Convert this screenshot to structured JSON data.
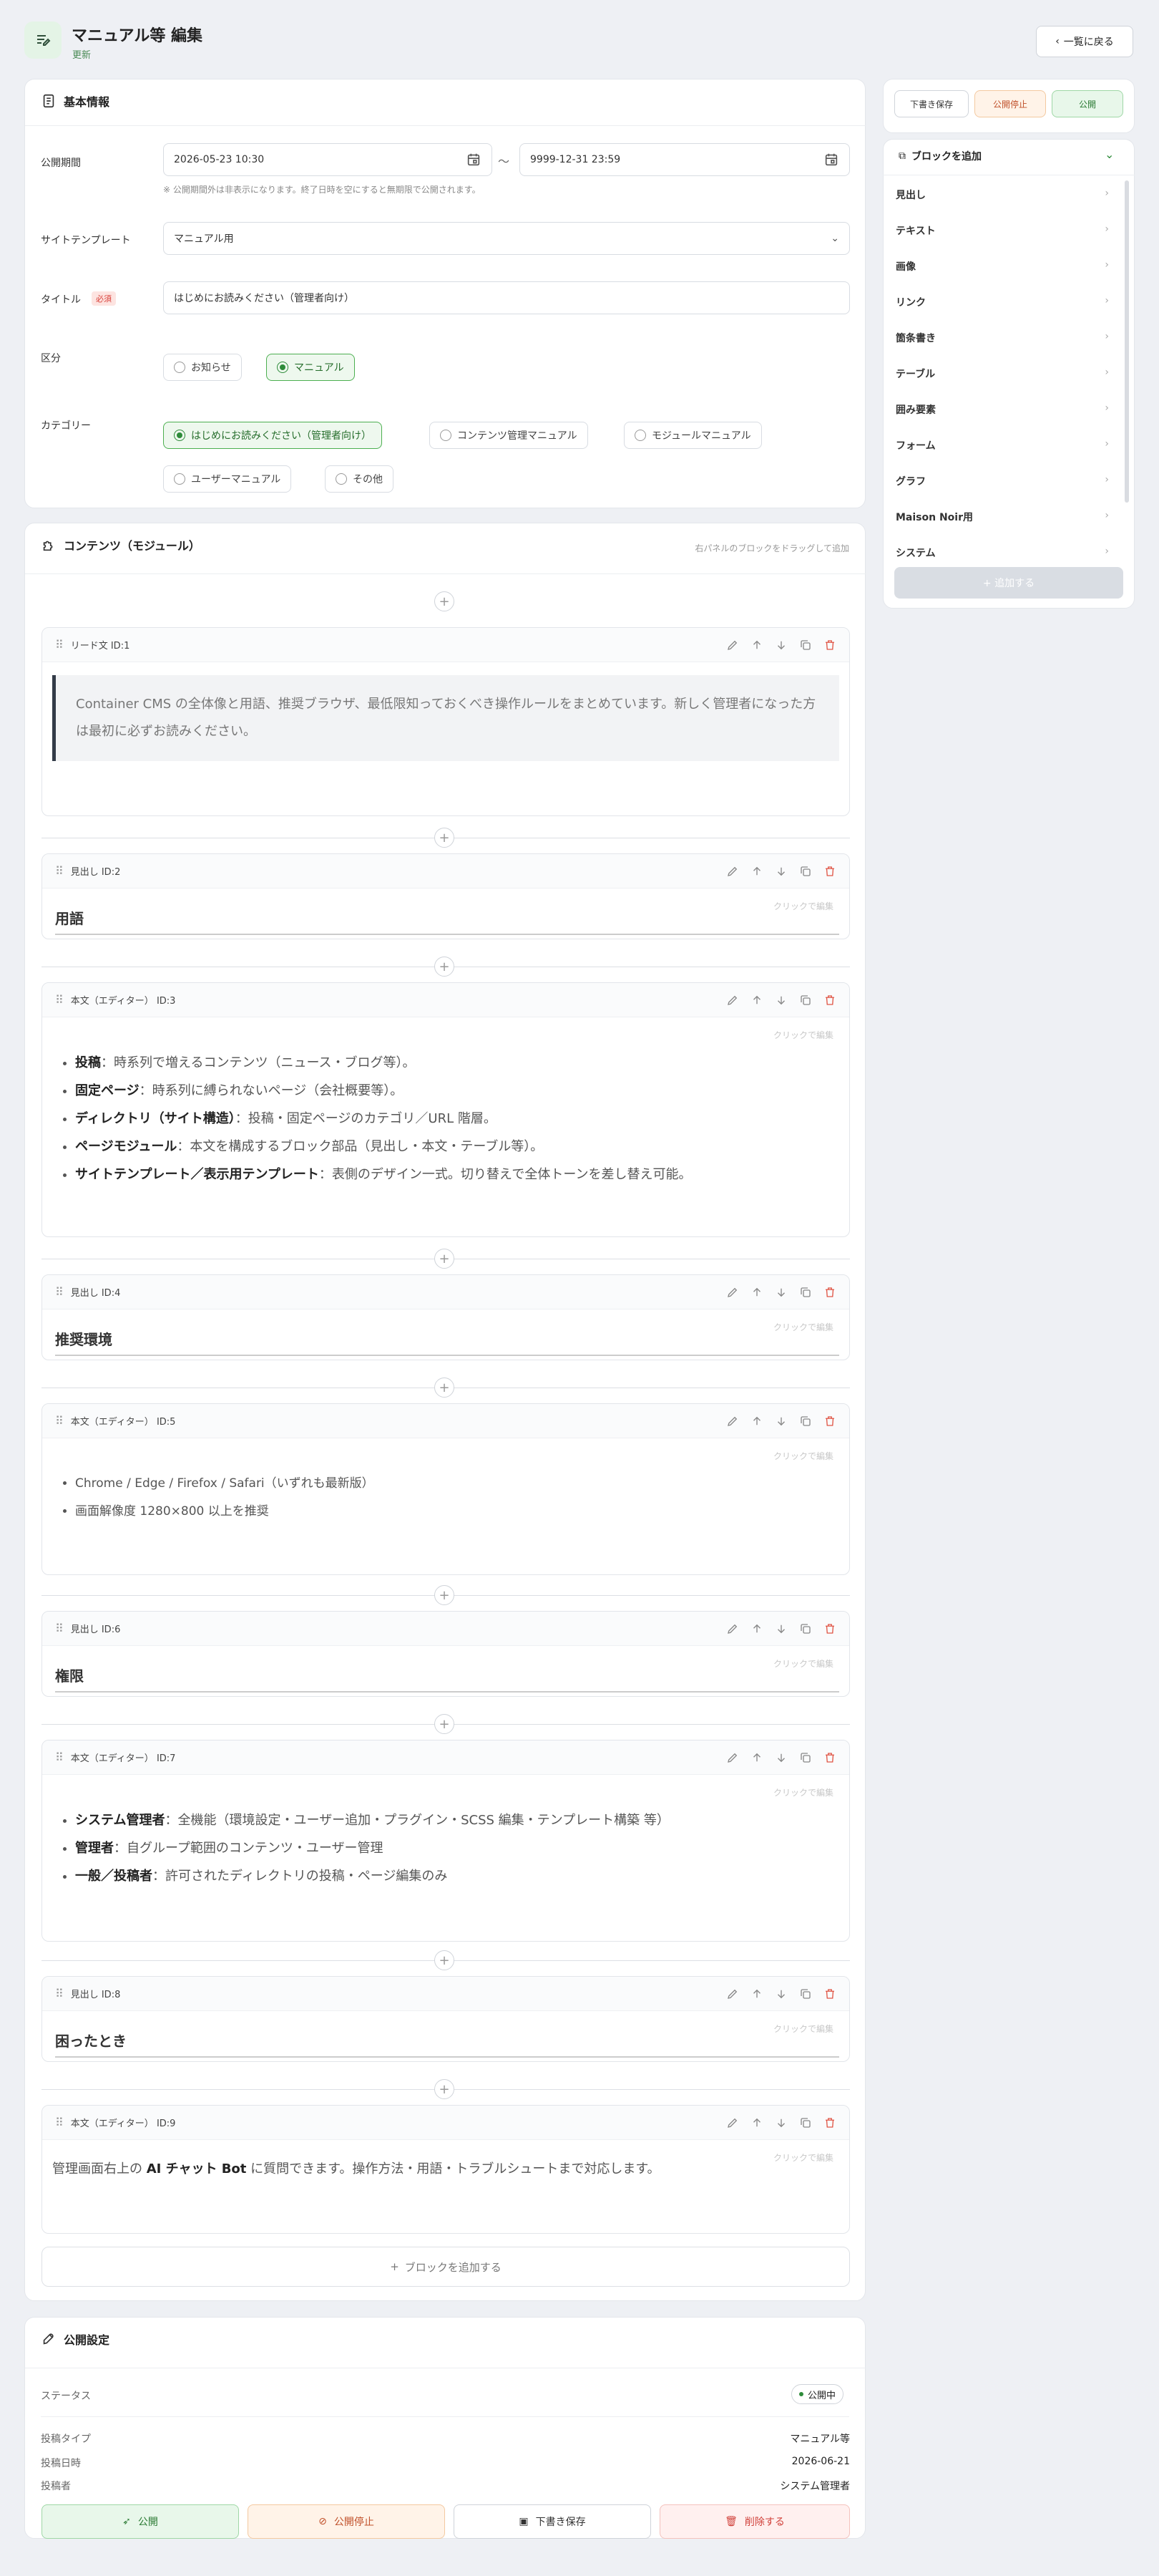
{
  "header": {
    "title": "マニュアル等 編集",
    "subtitle": "更新",
    "back_label": "一覧に戻る"
  },
  "basic": {
    "title": "基本情報",
    "period_label": "公開期間",
    "period_start": "2026-05-23 10:30",
    "period_sep": "〜",
    "period_end": "9999-12-31 23:59",
    "period_note": "※ 公開期間外は非表示になります。終了日時を空にすると無期限で公開されます。",
    "template_label": "サイトテンプレート",
    "template_value": "マニュアル用",
    "title_label": "タイトル",
    "required_badge": "必須",
    "title_value": "はじめにお読みください（管理者向け）",
    "kubun_label": "区分",
    "kubun_options": [
      "お知らせ",
      "マニュアル"
    ],
    "category_label": "カテゴリー",
    "category_options": [
      "はじめにお読みください（管理者向け）",
      "コンテンツ管理マニュアル",
      "モジュールマニュアル",
      "ユーザーマニュアル",
      "その他"
    ]
  },
  "contents": {
    "title": "コンテンツ（モジュール）",
    "hint": "右パネルのブロックをドラッグして追加",
    "click_edit": "クリックで編集",
    "add_block": "ブロックを追加する",
    "blocks": [
      {
        "label": "リード文 ID:1",
        "text": "Container CMS の全体像と用語、推奨ブラウザ、最低限知っておくべき操作ルールをまとめています。新しく管理者になった方は最初に必ずお読みください。"
      },
      {
        "label": "見出し ID:2",
        "text": "用語"
      },
      {
        "label": "本文（エディター） ID:3",
        "items": [
          {
            "b": "投稿",
            "t": "：時系列で増えるコンテンツ（ニュース・ブログ等）。"
          },
          {
            "b": "固定ページ",
            "t": "：時系列に縛られないページ（会社概要等）。"
          },
          {
            "b": "ディレクトリ（サイト構造）",
            "t": "：投稿・固定ページのカテゴリ／URL 階層。"
          },
          {
            "b": "ページモジュール",
            "t": "：本文を構成するブロック部品（見出し・本文・テーブル等）。"
          },
          {
            "b": "サイトテンプレート／表示用テンプレート",
            "t": "：表側のデザイン一式。切り替えで全体トーンを差し替え可能。"
          }
        ]
      },
      {
        "label": "見出し ID:4",
        "text": "推奨環境"
      },
      {
        "label": "本文（エディター） ID:5",
        "items": [
          {
            "b": "",
            "t": "Chrome / Edge / Firefox / Safari（いずれも最新版）"
          },
          {
            "b": "",
            "t": "画面解像度 1280×800 以上を推奨"
          }
        ]
      },
      {
        "label": "見出し ID:6",
        "text": "権限"
      },
      {
        "label": "本文（エディター） ID:7",
        "items": [
          {
            "b": "システム管理者",
            "t": "：全機能（環境設定・ユーザー追加・プラグイン・SCSS 編集・テンプレート構築 等）"
          },
          {
            "b": "管理者",
            "t": "：自グループ範囲のコンテンツ・ユーザー管理"
          },
          {
            "b": "一般／投稿者",
            "t": "：許可されたディレクトリの投稿・ページ編集のみ"
          }
        ]
      },
      {
        "label": "見出し ID:8",
        "text": "困ったとき"
      },
      {
        "label": "本文（エディター） ID:9",
        "pre": "管理画面右上の ",
        "b": "AI チャット Bot",
        "post": " に質問できます。操作方法・用語・トラブルシュートまで対応します。"
      }
    ]
  },
  "publish": {
    "title": "公開設定",
    "status_label": "ステータス",
    "status_value": "公開中",
    "type_label": "投稿タイプ",
    "type_value": "マニュアル等",
    "date_label": "投稿日時",
    "date_value": "2026-06-21",
    "author_label": "投稿者",
    "author_value": "システム管理者",
    "btn_publish": "公開",
    "btn_unpublish": "公開停止",
    "btn_draft": "下書き保存",
    "btn_delete": "削除する"
  },
  "side": {
    "btn_draft": "下書き保存",
    "btn_unpublish": "公開停止",
    "btn_publish": "公開",
    "add_title": "ブロックを追加",
    "items": [
      "見出し",
      "テキスト",
      "画像",
      "リンク",
      "箇条書き",
      "テーブル",
      "囲み要素",
      "フォーム",
      "グラフ",
      "Maison Noir用",
      "システム"
    ],
    "add_button": "+ 追加する"
  },
  "colors": {
    "accent": "#2e8b3a",
    "danger": "#e05545",
    "warning": "#d9822b"
  }
}
